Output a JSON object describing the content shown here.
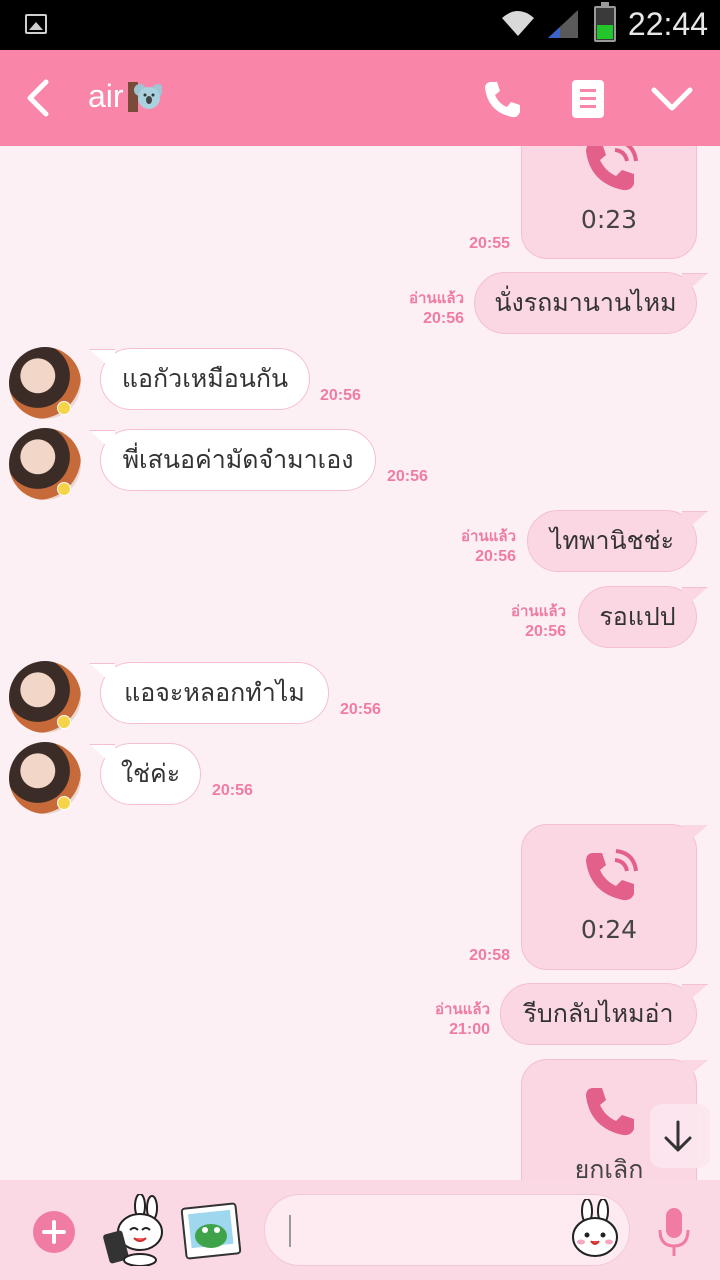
{
  "status_bar": {
    "time": "22:44",
    "icons": [
      "gallery-icon",
      "wifi-icon",
      "signal-icon",
      "battery-icon"
    ]
  },
  "header": {
    "title": "air",
    "title_emoji": "koala-icon",
    "actions": [
      "back-icon",
      "phone-icon",
      "notes-icon",
      "chevron-down-icon"
    ],
    "color": "#f985a9"
  },
  "messages": [
    {
      "type": "call",
      "dir": "out",
      "text": "0:23",
      "time": "20:55",
      "read": ""
    },
    {
      "type": "text",
      "dir": "out",
      "text": "นั่งรถมานานไหม",
      "time": "20:56",
      "read": "อ่านแล้ว"
    },
    {
      "type": "text",
      "dir": "in",
      "text": "แอกัวเหมือนกัน",
      "time": "20:56"
    },
    {
      "type": "text",
      "dir": "in",
      "text": "พี่เสนอค่ามัดจำมาเอง",
      "time": "20:56"
    },
    {
      "type": "text",
      "dir": "out",
      "text": "ไทพานิชช่ะ",
      "time": "20:56",
      "read": "อ่านแล้ว"
    },
    {
      "type": "text",
      "dir": "out",
      "text": "รอแปป",
      "time": "20:56",
      "read": "อ่านแล้ว"
    },
    {
      "type": "text",
      "dir": "in",
      "text": "แอจะหลอกทำไม",
      "time": "20:56"
    },
    {
      "type": "text",
      "dir": "in",
      "text": "ใช่ค่ะ",
      "time": "20:56"
    },
    {
      "type": "call",
      "dir": "out",
      "text": "0:24",
      "time": "20:58",
      "read": ""
    },
    {
      "type": "text",
      "dir": "out",
      "text": "รีบกลับไหมอ่า",
      "time": "21:00",
      "read": "อ่านแล้ว"
    },
    {
      "type": "call",
      "dir": "out",
      "text": "ยกเลิก",
      "time": "",
      "read": ""
    }
  ],
  "input_bar": {
    "placeholder": "",
    "icons": [
      "plus-icon",
      "sticker-icon",
      "photo-icon",
      "emoji-icon",
      "microphone-icon"
    ]
  },
  "colors": {
    "accent": "#f07ca3",
    "outgoing_bubble": "#fbd6e3",
    "background": "#fcf0f4"
  }
}
